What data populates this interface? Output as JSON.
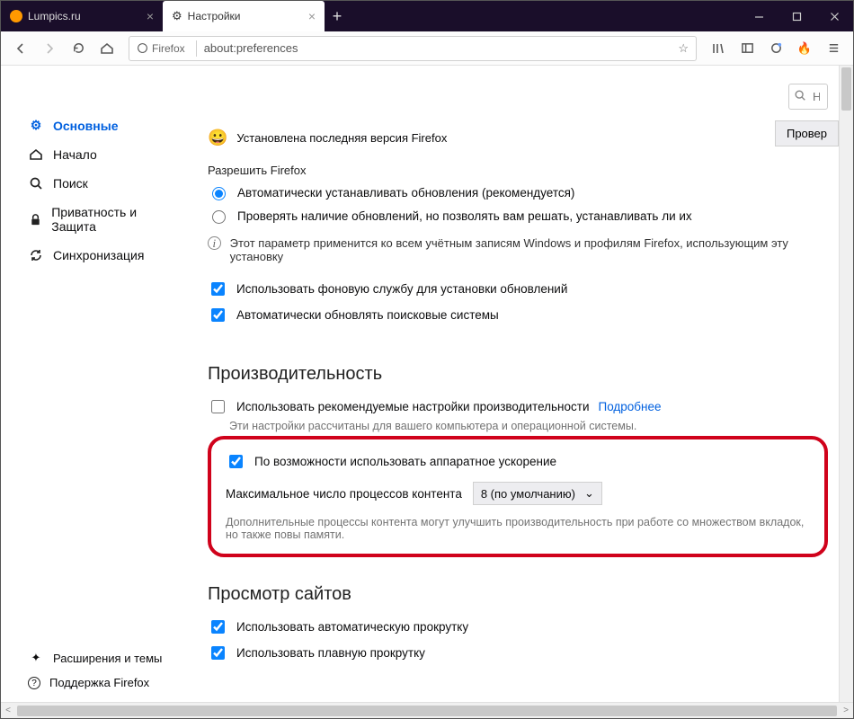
{
  "tabs": {
    "inactive": "Lumpics.ru",
    "active": "Настройки"
  },
  "urlbar": {
    "identity": "Firefox",
    "url": "about:preferences"
  },
  "search": {
    "placeholder": "Най"
  },
  "sidebar": {
    "general": "Основные",
    "home": "Начало",
    "search": "Поиск",
    "privacy": "Приватность и Защита",
    "sync": "Синхронизация",
    "extensions": "Расширения и темы",
    "support": "Поддержка Firefox"
  },
  "updates": {
    "status": "Установлена последняя версия Firefox",
    "check_button": "Провер",
    "allow_label": "Разрешить Firefox",
    "radio_auto": "Автоматически устанавливать обновления (рекомендуется)",
    "radio_check": "Проверять наличие обновлений, но позволять вам решать, устанавливать ли их",
    "note": "Этот параметр применится ко всем учётным записям Windows и профилям Firefox, использующим эту установку",
    "cb_service": "Использовать фоновую службу для установки обновлений",
    "cb_engines": "Автоматически обновлять поисковые системы"
  },
  "performance": {
    "title": "Производительность",
    "cb_recommended": "Использовать рекомендуемые настройки производительности",
    "more": "Подробнее",
    "desc1": "Эти настройки рассчитаны для вашего компьютера и операционной системы.",
    "cb_hwaccel": "По возможности использовать аппаратное ускорение",
    "procs_label": "Максимальное число процессов контента",
    "procs_value": "8 (по умолчанию)",
    "desc2": "Дополнительные процессы контента могут улучшить производительность при работе со множеством вкладок, но также повы памяти."
  },
  "browsing": {
    "title": "Просмотр сайтов",
    "cb_autoscroll": "Использовать автоматическую прокрутку",
    "cb_smooth": "Использовать плавную прокрутку"
  }
}
